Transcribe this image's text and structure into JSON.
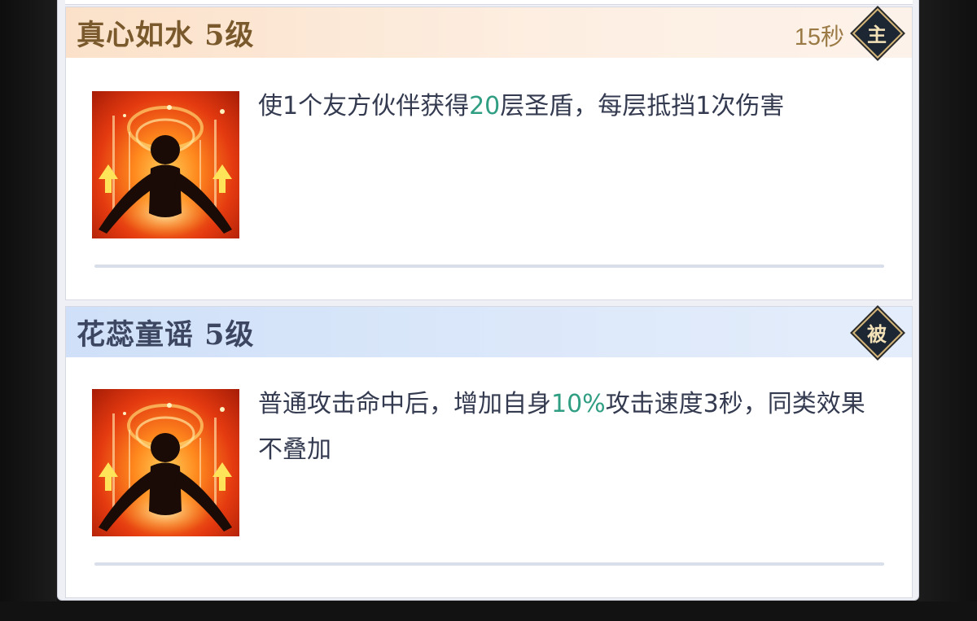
{
  "skills": [
    {
      "name": "真心如水 5级",
      "cooldown": "15秒",
      "type_badge": "主",
      "icon": "buff-silhouette-icon",
      "description": {
        "pre": "使1个友方伙伴获得",
        "highlight": "20",
        "post": "层圣盾，每层抵挡1次伤害"
      }
    },
    {
      "name": "花蕊童谣 5级",
      "type_badge": "被",
      "icon": "buff-silhouette-icon",
      "description": {
        "pre": "普通攻击命中后，增加自身",
        "highlight": "10%",
        "post": "攻击速度3秒，同类效果不叠加"
      }
    }
  ],
  "colors": {
    "highlight": "#2f9e83",
    "active_header": "#fbe1c9",
    "passive_header": "#cfe0f8"
  }
}
